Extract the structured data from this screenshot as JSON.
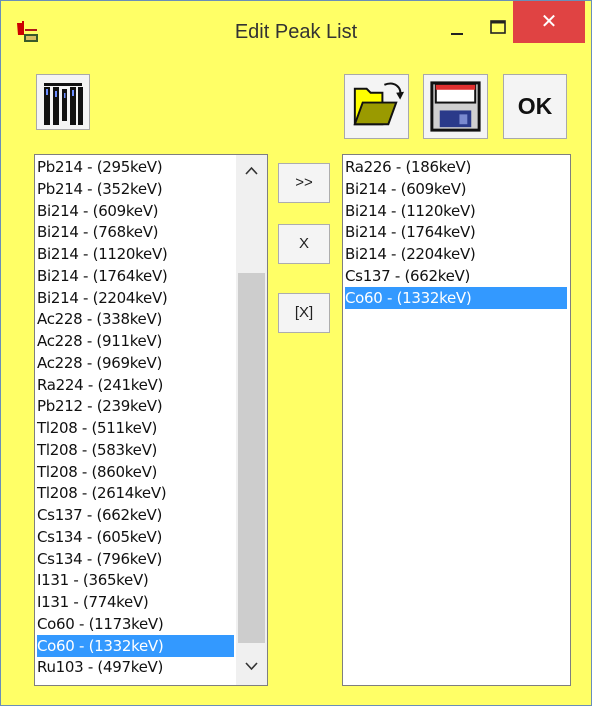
{
  "window": {
    "title": "Edit Peak List",
    "close_glyph": "✕"
  },
  "toolbar": {
    "ok_label": "OK",
    "icons": [
      "spectrum-icon",
      "open-folder-icon",
      "save-floppy-icon"
    ]
  },
  "buttons": {
    "add": ">>",
    "remove": "X",
    "remove_all": "[X]"
  },
  "available_list": {
    "items": [
      "Pb214 - (295keV)",
      "Pb214 - (352keV)",
      "Bi214 - (609keV)",
      "Bi214 - (768keV)",
      "Bi214 - (1120keV)",
      "Bi214 - (1764keV)",
      "Bi214 - (2204keV)",
      "Ac228 - (338keV)",
      "Ac228 - (911keV)",
      "Ac228 - (969keV)",
      "Ra224 - (241keV)",
      "Pb212 - (239keV)",
      "Tl208 - (511keV)",
      "Tl208 - (583keV)",
      "Tl208 - (860keV)",
      "Tl208 - (2614keV)",
      "Cs137 - (662keV)",
      "Cs134 - (605keV)",
      "Cs134 - (796keV)",
      "I131 - (365keV)",
      "I131 - (774keV)",
      "Co60 - (1173keV)",
      "Co60 - (1332keV)",
      "Ru103 - (497keV)"
    ],
    "selected": "Co60 - (1332keV)"
  },
  "selected_list": {
    "items": [
      "Ra226 - (186keV)",
      "Bi214 - (609keV)",
      "Bi214 - (1120keV)",
      "Bi214 - (1764keV)",
      "Bi214 - (2204keV)",
      "Cs137 - (662keV)",
      "Co60 - (1332keV)"
    ],
    "selected": "Co60 - (1332keV)"
  },
  "colors": {
    "background": "#ffff66",
    "selection": "#3399ff",
    "close": "#e04343"
  }
}
